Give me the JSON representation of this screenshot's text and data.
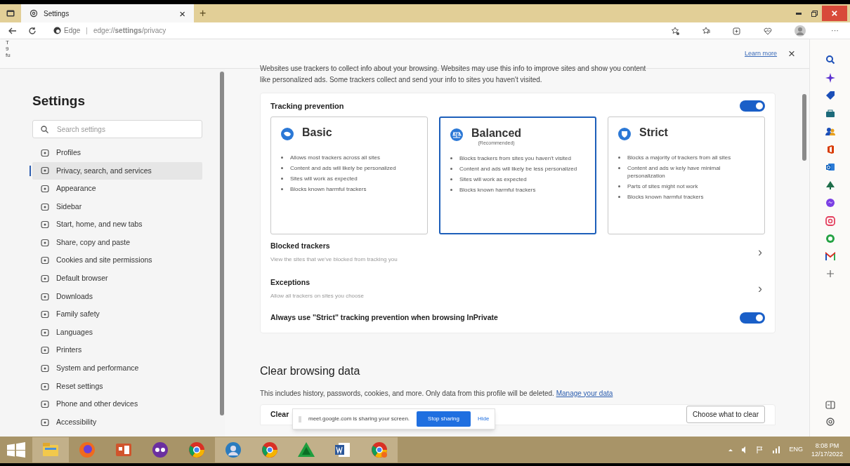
{
  "browser": {
    "tab": {
      "label": "Settings",
      "close": "×"
    },
    "new_tab": "+",
    "window_controls": {
      "close": "×"
    },
    "address": {
      "site": "Edge",
      "separator": "|",
      "url": "edge://**settings**/privacy"
    },
    "more": "···"
  },
  "info_bar": {
    "fragments": [
      "T",
      "9",
      "fu"
    ],
    "link": "Learn more",
    "close": "×"
  },
  "sidebar": {
    "title": "Settings",
    "search": {
      "placeholder": "Search settings"
    },
    "items": [
      {
        "label": "Profiles",
        "selected": false
      },
      {
        "label": "Privacy, search, and services",
        "selected": true
      },
      {
        "label": "Appearance",
        "selected": false
      },
      {
        "label": "Sidebar",
        "selected": false
      },
      {
        "label": "Start, home, and new tabs",
        "selected": false
      },
      {
        "label": "Share, copy and paste",
        "selected": false
      },
      {
        "label": "Cookies and site permissions",
        "selected": false
      },
      {
        "label": "Default browser",
        "selected": false
      },
      {
        "label": "Downloads",
        "selected": false
      },
      {
        "label": "Family safety",
        "selected": false
      },
      {
        "label": "Languages",
        "selected": false
      },
      {
        "label": "Printers",
        "selected": false
      },
      {
        "label": "System and performance",
        "selected": false
      },
      {
        "label": "Reset settings",
        "selected": false
      },
      {
        "label": "Phone and other devices",
        "selected": false
      },
      {
        "label": "Accessibility",
        "selected": false
      }
    ]
  },
  "content": {
    "intro": [
      "Websites use trackers to collect info about your browsing. Websites may use this info to improve sites and show you content",
      "like personalized ads. Some trackers collect and send your info to sites you haven't visited."
    ],
    "tracking": {
      "label": "Tracking prevention",
      "on": true,
      "options": [
        {
          "title": "Basic",
          "selected": false,
          "bullets": [
            "Allows most trackers across all sites",
            "Content and ads will likely be personalized",
            "Sites will work as expected",
            "Blocks known harmful trackers"
          ]
        },
        {
          "title": "Balanced",
          "subtitle": "(Recommended)",
          "selected": true,
          "bullets": [
            "Blocks trackers from sites you haven't visited",
            "Content and ads will likely be less personalized",
            "Sites will work as expected",
            "Blocks known harmful trackers"
          ]
        },
        {
          "title": "Strict",
          "selected": false,
          "bullets": [
            "Blocks a majority of trackers from all sites",
            "Content and ads w    kely have minimal personalization",
            "Parts of sites might not work",
            "Blocks known harmful trackers"
          ]
        }
      ],
      "rows": [
        {
          "title": "Blocked trackers",
          "description": "View the sites that we've blocked from tracking you",
          "chevron": "›"
        },
        {
          "title": "Exceptions",
          "description": "Allow all trackers on sites you choose",
          "chevron": "›"
        }
      ],
      "inprivate": {
        "label": "Always use \"Strict\" tracking prevention when browsing InPrivate",
        "on": true
      }
    },
    "clear": {
      "title": "Clear browsing data",
      "description": "This includes history, passwords, cookies, and more. Only data from this profile will be deleted.",
      "link": "Manage your data",
      "row_label": "Clear",
      "button": "Choose what to clear"
    }
  },
  "sharing_bar": {
    "text": "meet.google.com is sharing your screen.",
    "stop": "Stop sharing",
    "hide": "Hide"
  },
  "taskbar": {
    "tray": {
      "language": "ENG",
      "time": "8:08 PM",
      "date": "12/17/2022"
    }
  }
}
